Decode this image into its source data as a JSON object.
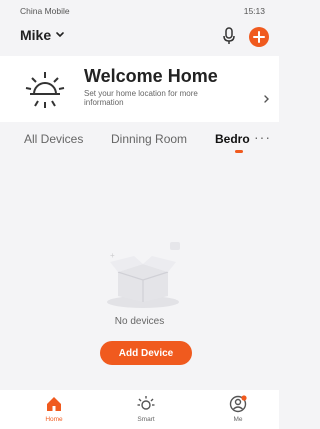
{
  "status": {
    "carrier": "China Mobile",
    "time": "15:13"
  },
  "header": {
    "user": "Mike"
  },
  "welcome": {
    "title": "Welcome Home",
    "subtitle": "Set your home location for more information"
  },
  "tabs": [
    {
      "label": "All Devices"
    },
    {
      "label": "Dinning Room"
    },
    {
      "label": "Bedro"
    }
  ],
  "empty_state": {
    "message": "No devices",
    "button": "Add Device"
  },
  "bottom_nav": [
    {
      "label": "Home",
      "icon": "home-icon"
    },
    {
      "label": "Smart",
      "icon": "sun-icon"
    },
    {
      "label": "Me",
      "icon": "profile-icon"
    }
  ],
  "colors": {
    "accent": "#f05a1e"
  }
}
